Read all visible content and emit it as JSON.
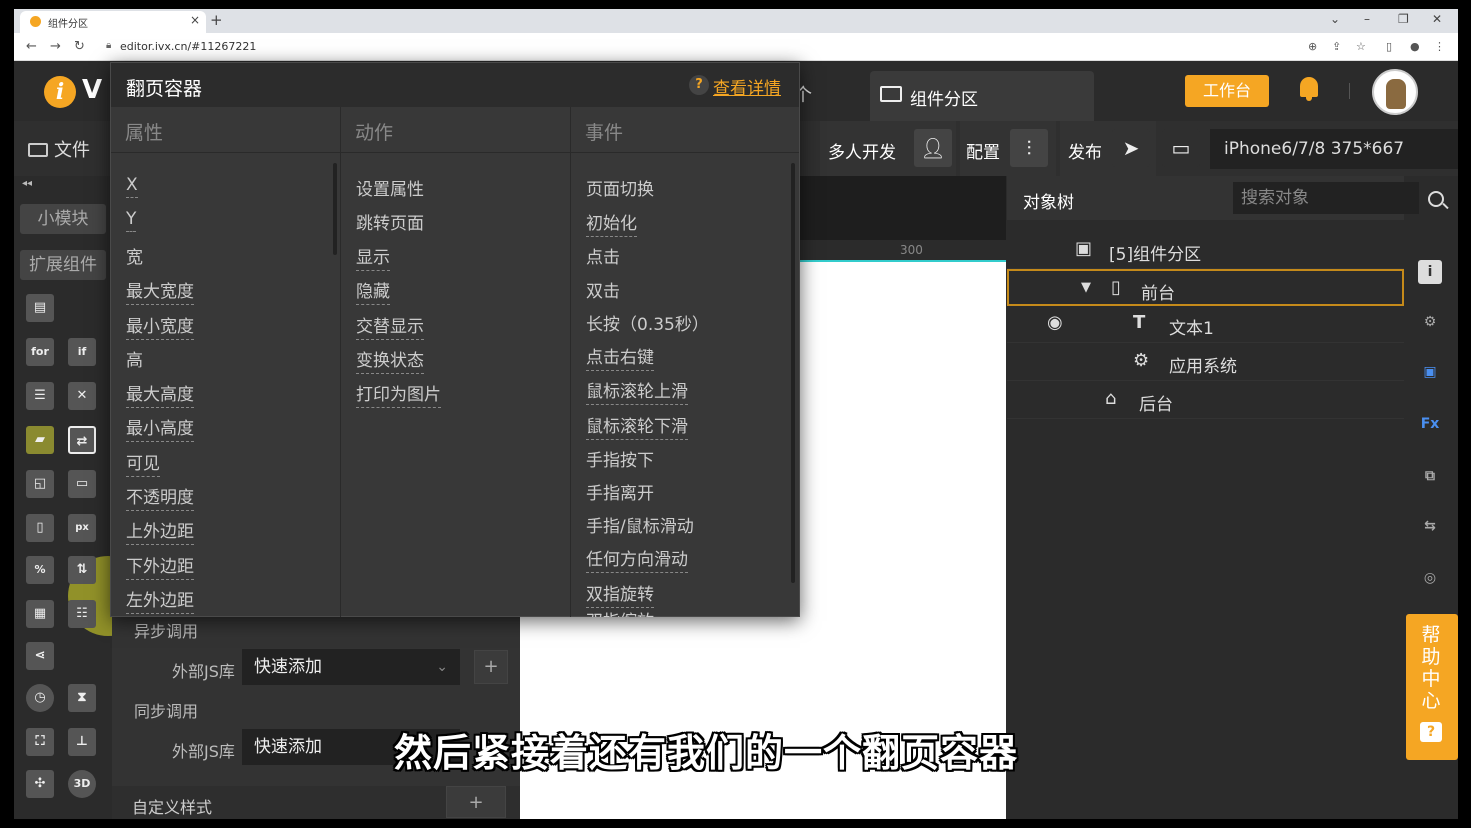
{
  "browser": {
    "tab_title": "组件分区",
    "url": "editor.ivx.cn/#11267221",
    "new_tab": "+",
    "tab_close": "×"
  },
  "header": {
    "logo_i": "i",
    "logo_v": "V",
    "tab_overflow": "个",
    "component_tab": "组件分区",
    "workbench_button": "工作台"
  },
  "toolbar": {
    "file_label": "文件",
    "multi_dev_label": "多人开发",
    "config_label": "配置",
    "publish_label": "发布",
    "device_select": "iPhone6/7/8 375*667"
  },
  "sidebar": {
    "collapse": "◂◂",
    "tabs": [
      "小模块",
      "扩展组件"
    ],
    "icons": [
      "for",
      "if",
      "px",
      "%",
      "3D",
      "[T]",
      "[N]"
    ]
  },
  "popup": {
    "title": "翻页容器",
    "help_mark": "?",
    "detail_link": "查看详情",
    "columns": [
      {
        "header": "属性",
        "items": [
          "X",
          "Y",
          "宽",
          "最大宽度",
          "最小宽度",
          "高",
          "最大高度",
          "最小高度",
          "可见",
          "不透明度",
          "上外边距",
          "下外边距",
          "左外边距"
        ]
      },
      {
        "header": "动作",
        "items": [
          "设置属性",
          "跳转页面",
          "显示",
          "隐藏",
          "交替显示",
          "变换状态",
          "打印为图片"
        ]
      },
      {
        "header": "事件",
        "items": [
          "页面切换",
          "初始化",
          "点击",
          "双击",
          "长按（0.35秒）",
          "点击右键",
          "鼠标滚轮上滑",
          "鼠标滚轮下滑",
          "手指按下",
          "手指离开",
          "手指/鼠标滑动",
          "任何方向滑动",
          "双指旋转",
          "双指缩放"
        ]
      }
    ]
  },
  "props": {
    "async_call": "异步调用",
    "external_js_1": "外部JS库",
    "quick_add_1": "快速添加",
    "sync_call": "同步调用",
    "external_js_2": "外部JS库",
    "quick_add_2": "快速添加",
    "custom_style": "自定义样式",
    "plus": "+"
  },
  "canvas": {
    "ruler_mark": "300"
  },
  "object_tree": {
    "title": "对象树",
    "search_placeholder": "搜索对象",
    "nodes": [
      "[5]组件分区",
      "前台",
      "文本1",
      "应用系统",
      "后台"
    ]
  },
  "help_center": {
    "label": "帮助中心",
    "mark": "?"
  },
  "subtitle": "然后紧接着还有我们的一个翻页容器",
  "colors": {
    "accent": "#f5a623",
    "selection_border": "#c58a1a",
    "canvas_guide": "#33cccc"
  }
}
